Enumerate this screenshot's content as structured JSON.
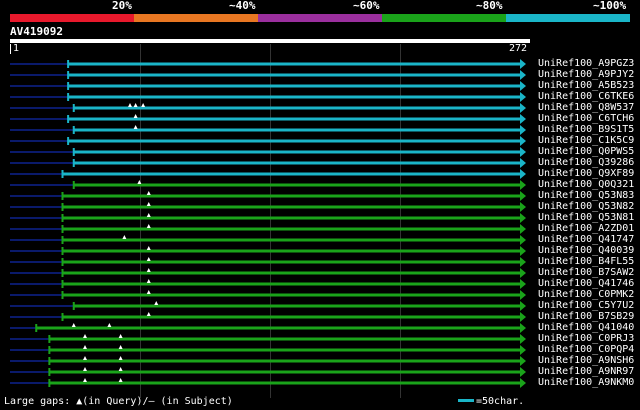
{
  "legend": {
    "labels": [
      "20%",
      "~40%",
      "~60%",
      "~80%",
      "~100%"
    ],
    "colors": [
      "#e8192c",
      "#e87722",
      "#9b2f9e",
      "#1aa31a",
      "#1ab5c8"
    ]
  },
  "query": {
    "name": "AV419092",
    "ruler_start": "1",
    "ruler_end": "272"
  },
  "colors": {
    "cyan": "#1ab5c8",
    "green": "#1aa31a",
    "stub": "#0a1a6b",
    "gap": "#ffffff"
  },
  "hits": [
    {
      "id": "UniRef100_A9PGZ3",
      "color": "cyan",
      "start": 31,
      "gaps": []
    },
    {
      "id": "UniRef100_A9PJY2",
      "color": "cyan",
      "start": 31,
      "gaps": []
    },
    {
      "id": "UniRef100_A5B523",
      "color": "cyan",
      "start": 31,
      "gaps": []
    },
    {
      "id": "UniRef100_C6TKE6",
      "color": "cyan",
      "start": 31,
      "gaps": []
    },
    {
      "id": "UniRef100_Q8W537",
      "color": "cyan",
      "start": 34,
      "gaps": [
        64,
        67,
        71
      ]
    },
    {
      "id": "UniRef100_C6TCH6",
      "color": "cyan",
      "start": 31,
      "gaps": [
        67
      ]
    },
    {
      "id": "UniRef100_B9S1T5",
      "color": "cyan",
      "start": 34,
      "gaps": [
        67
      ]
    },
    {
      "id": "UniRef100_C1K5C9",
      "color": "cyan",
      "start": 31,
      "gaps": []
    },
    {
      "id": "UniRef100_Q0PWS5",
      "color": "cyan",
      "start": 34,
      "gaps": []
    },
    {
      "id": "UniRef100_Q39286",
      "color": "cyan",
      "start": 34,
      "gaps": []
    },
    {
      "id": "UniRef100_Q9XF89",
      "color": "cyan",
      "start": 28,
      "gaps": []
    },
    {
      "id": "UniRef100_Q0Q321",
      "color": "green",
      "start": 34,
      "gaps": [
        69
      ]
    },
    {
      "id": "UniRef100_Q53N83",
      "color": "green",
      "start": 28,
      "gaps": [
        74
      ]
    },
    {
      "id": "UniRef100_Q53N82",
      "color": "green",
      "start": 28,
      "gaps": [
        74
      ]
    },
    {
      "id": "UniRef100_Q53N81",
      "color": "green",
      "start": 28,
      "gaps": [
        74
      ]
    },
    {
      "id": "UniRef100_A2ZD01",
      "color": "green",
      "start": 28,
      "gaps": [
        74
      ]
    },
    {
      "id": "UniRef100_Q41747",
      "color": "green",
      "start": 28,
      "gaps": [
        61
      ]
    },
    {
      "id": "UniRef100_Q40039",
      "color": "green",
      "start": 28,
      "gaps": [
        74
      ]
    },
    {
      "id": "UniRef100_B4FL55",
      "color": "green",
      "start": 28,
      "gaps": [
        74
      ]
    },
    {
      "id": "UniRef100_B7SAW2",
      "color": "green",
      "start": 28,
      "gaps": [
        74
      ]
    },
    {
      "id": "UniRef100_Q41746",
      "color": "green",
      "start": 28,
      "gaps": [
        74
      ]
    },
    {
      "id": "UniRef100_C0PMK2",
      "color": "green",
      "start": 28,
      "gaps": [
        74
      ]
    },
    {
      "id": "UniRef100_C5Y7U2",
      "color": "green",
      "start": 34,
      "gaps": [
        78
      ]
    },
    {
      "id": "UniRef100_B7SB29",
      "color": "green",
      "start": 28,
      "gaps": [
        74
      ]
    },
    {
      "id": "UniRef100_Q41040",
      "color": "green",
      "start": 14,
      "gaps": [
        34,
        53
      ]
    },
    {
      "id": "UniRef100_C0PRJ3",
      "color": "green",
      "start": 21,
      "gaps": [
        40,
        59
      ]
    },
    {
      "id": "UniRef100_C0PQP4",
      "color": "green",
      "start": 21,
      "gaps": [
        40,
        59
      ]
    },
    {
      "id": "UniRef100_A9NSH6",
      "color": "green",
      "start": 21,
      "gaps": [
        40,
        59
      ]
    },
    {
      "id": "UniRef100_A9NR97",
      "color": "green",
      "start": 21,
      "gaps": [
        40,
        59
      ]
    },
    {
      "id": "UniRef100_A9NKM0",
      "color": "green",
      "start": 21,
      "gaps": [
        40,
        59
      ]
    }
  ],
  "footer": {
    "gaps_text": "Large gaps: ▲(in Query)/— (in Subject)",
    "scale_text": "=50char."
  }
}
